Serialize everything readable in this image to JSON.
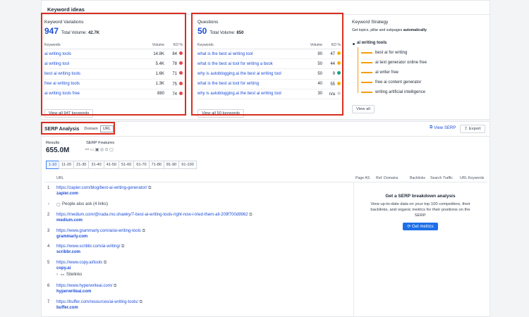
{
  "header": {
    "title": "Keyword ideas"
  },
  "keyword_variations": {
    "title": "Keyword Variations",
    "count": "947",
    "total_label": "Total Volume:",
    "total_value": "42.7K",
    "col_keywords": "Keywords",
    "col_volume": "Volume",
    "col_kd": "KD %",
    "rows": [
      {
        "keyword": "ai writing tools",
        "volume": "14.8K",
        "kd": "84",
        "color": "#e5484d"
      },
      {
        "keyword": "ai writing tool",
        "volume": "5.4K",
        "kd": "78",
        "color": "#e5484d"
      },
      {
        "keyword": "best ai writing tools",
        "volume": "1.6K",
        "kd": "71",
        "color": "#e5484d"
      },
      {
        "keyword": "free ai writing tools",
        "volume": "1.3K",
        "kd": "75",
        "color": "#e5484d"
      },
      {
        "keyword": "ai writing tools free",
        "volume": "880",
        "kd": "74",
        "color": "#e5484d"
      }
    ],
    "view_all": "View all 947 keywords"
  },
  "questions": {
    "title": "Questions",
    "count": "50",
    "total_label": "Total Volume:",
    "total_value": "850",
    "col_keywords": "Keywords",
    "col_volume": "Volume",
    "col_kd": "KD %",
    "rows": [
      {
        "keyword": "what is the best ai writing tool",
        "volume": "90",
        "kd": "47",
        "color": "#f5b40a"
      },
      {
        "keyword": "what is the best ai tool for writing a book",
        "volume": "50",
        "kd": "44",
        "color": "#f5b40a"
      },
      {
        "keyword": "why is autoblogging.ai the best ai writing tool",
        "volume": "50",
        "kd": "9",
        "color": "#12a37f"
      },
      {
        "keyword": "what is the best ai tool for writing",
        "volume": "40",
        "kd": "55",
        "color": "#f5b40a"
      },
      {
        "keyword": "why is autoblogging.ai the best ai writing tool",
        "volume": "30",
        "kd": "n/a",
        "color": "#d1d5db"
      }
    ],
    "view_all": "View all 50 keywords"
  },
  "strategy": {
    "title": "Keyword Strategy",
    "subtitle_pre": "Get topics, pillar and subpages",
    "subtitle_bold": "automatically",
    "root": "ai writing tools",
    "items": [
      "best ai for writing",
      "ai text generator online free",
      "ai writer free",
      "free ai content generator",
      "writing artificial intelligence"
    ],
    "view_all": "View all"
  },
  "serp": {
    "title": "SERP Analysis",
    "tab_domain": "Domain",
    "tab_url": "URL",
    "view_serp": "View SERP",
    "export": "Export",
    "results_label": "Results",
    "results_value": "655.0M",
    "features_label": "SERP Features",
    "pages": [
      "1-10",
      "11-20",
      "21-30",
      "31-40",
      "41-50",
      "51-60",
      "61-70",
      "71-80",
      "81-90",
      "91-100"
    ],
    "col_url": "URL",
    "col_page_as": "Page AS",
    "col_ref_domains": "Ref. Domains",
    "col_backlinks": "Backlinks",
    "col_search_traffic": "Search Traffic",
    "col_url_keywords": "URL Keywords",
    "results": [
      {
        "num": "1",
        "url": "https://zapier.com/blog/best-ai-writing-generator/",
        "domain": "zapier.com"
      },
      {
        "num": "",
        "url": "",
        "domain": "",
        "paa": "People also ask (4 links)"
      },
      {
        "num": "2",
        "url": "https://medium.com/@nada.mo.shawky/7-best-ai-writing-tools-right-now-i-tried-them-all-209f700d9962",
        "domain": "medium.com"
      },
      {
        "num": "3",
        "url": "https://www.grammarly.com/ai/ai-writing-tools",
        "domain": "grammarly.com"
      },
      {
        "num": "4",
        "url": "https://www.scribbr.com/ai-writing/",
        "domain": "scribbr.com"
      },
      {
        "num": "5",
        "url": "https://www.copy.ai/tools",
        "domain": "copy.ai",
        "extra": "Sitelinks"
      },
      {
        "num": "6",
        "url": "https://www.hyperwriteai.com/",
        "domain": "hyperwriteai.com"
      },
      {
        "num": "7",
        "url": "https://buffer.com/resources/ai-writing-tools/",
        "domain": "buffer.com"
      }
    ],
    "cta_title": "Get a SERP breakdown analysis",
    "cta_text": "View up-to-date data on your top 100 competitors, their backlinks, and organic metrics for their positions on the SERP.",
    "cta_button": "Get metrics"
  }
}
